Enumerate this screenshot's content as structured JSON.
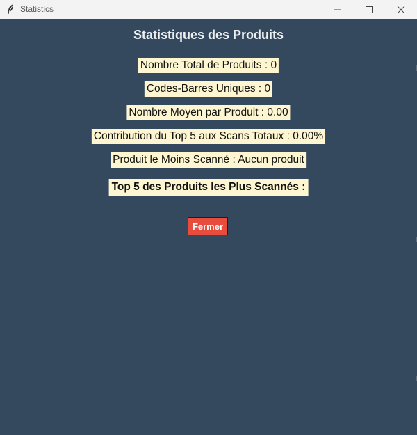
{
  "window": {
    "title": "Statistics",
    "icons": {
      "app": "feather-icon",
      "minimize": "minimize-icon",
      "maximize": "maximize-icon",
      "close": "close-icon"
    }
  },
  "colors": {
    "background": "#34495e",
    "label_background": "#fdf6d0",
    "close_button": "#e74c3c",
    "heading_text": "#ecf0f1"
  },
  "main": {
    "heading": "Statistiques des Produits",
    "stats": {
      "total_products": "Nombre Total de Produits : 0",
      "unique_barcodes": "Codes-Barres Uniques : 0",
      "average_per_product": "Nombre Moyen par Produit : 0.00",
      "top5_contribution": "Contribution du Top 5 aux Scans Totaux : 0.00%",
      "least_scanned": "Produit le Moins Scanné : Aucun produit",
      "top5_heading": "Top 5 des Produits les Plus Scannés :"
    },
    "close_button_label": "Fermer"
  }
}
